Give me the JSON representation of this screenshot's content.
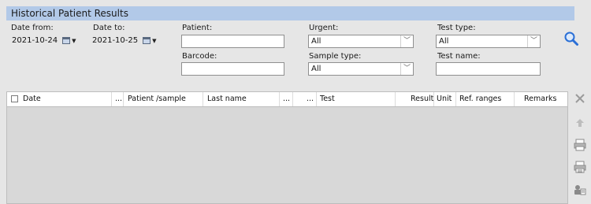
{
  "title": "Historical Patient Results",
  "filters": {
    "date_from_label": "Date from:",
    "date_from_value": "2021-10-24",
    "date_to_label": "Date to:",
    "date_to_value": "2021-10-25",
    "patient_label": "Patient:",
    "patient_value": "",
    "barcode_label": "Barcode:",
    "barcode_value": "",
    "urgent_label": "Urgent:",
    "urgent_value": "All",
    "sample_type_label": "Sample type:",
    "sample_type_value": "All",
    "test_type_label": "Test type:",
    "test_type_value": "All",
    "test_name_label": "Test name:",
    "test_name_value": ""
  },
  "grid": {
    "columns": [
      "Date",
      "...",
      "Patient /sample",
      "Last name",
      "...",
      "...",
      "Test",
      "Result",
      "Unit",
      "Ref. ranges",
      "Remarks"
    ]
  },
  "icons": {
    "search": "search-icon",
    "calendar": "calendar-icon",
    "delete": "close-icon",
    "upload": "upload-icon",
    "print": "printer-icon",
    "print_list": "print-list-icon",
    "patient_card": "patient-card-icon"
  },
  "colors": {
    "header_bar": "#b2c9e8",
    "background": "#e6e6e6",
    "accent": "#2a6fd6"
  }
}
